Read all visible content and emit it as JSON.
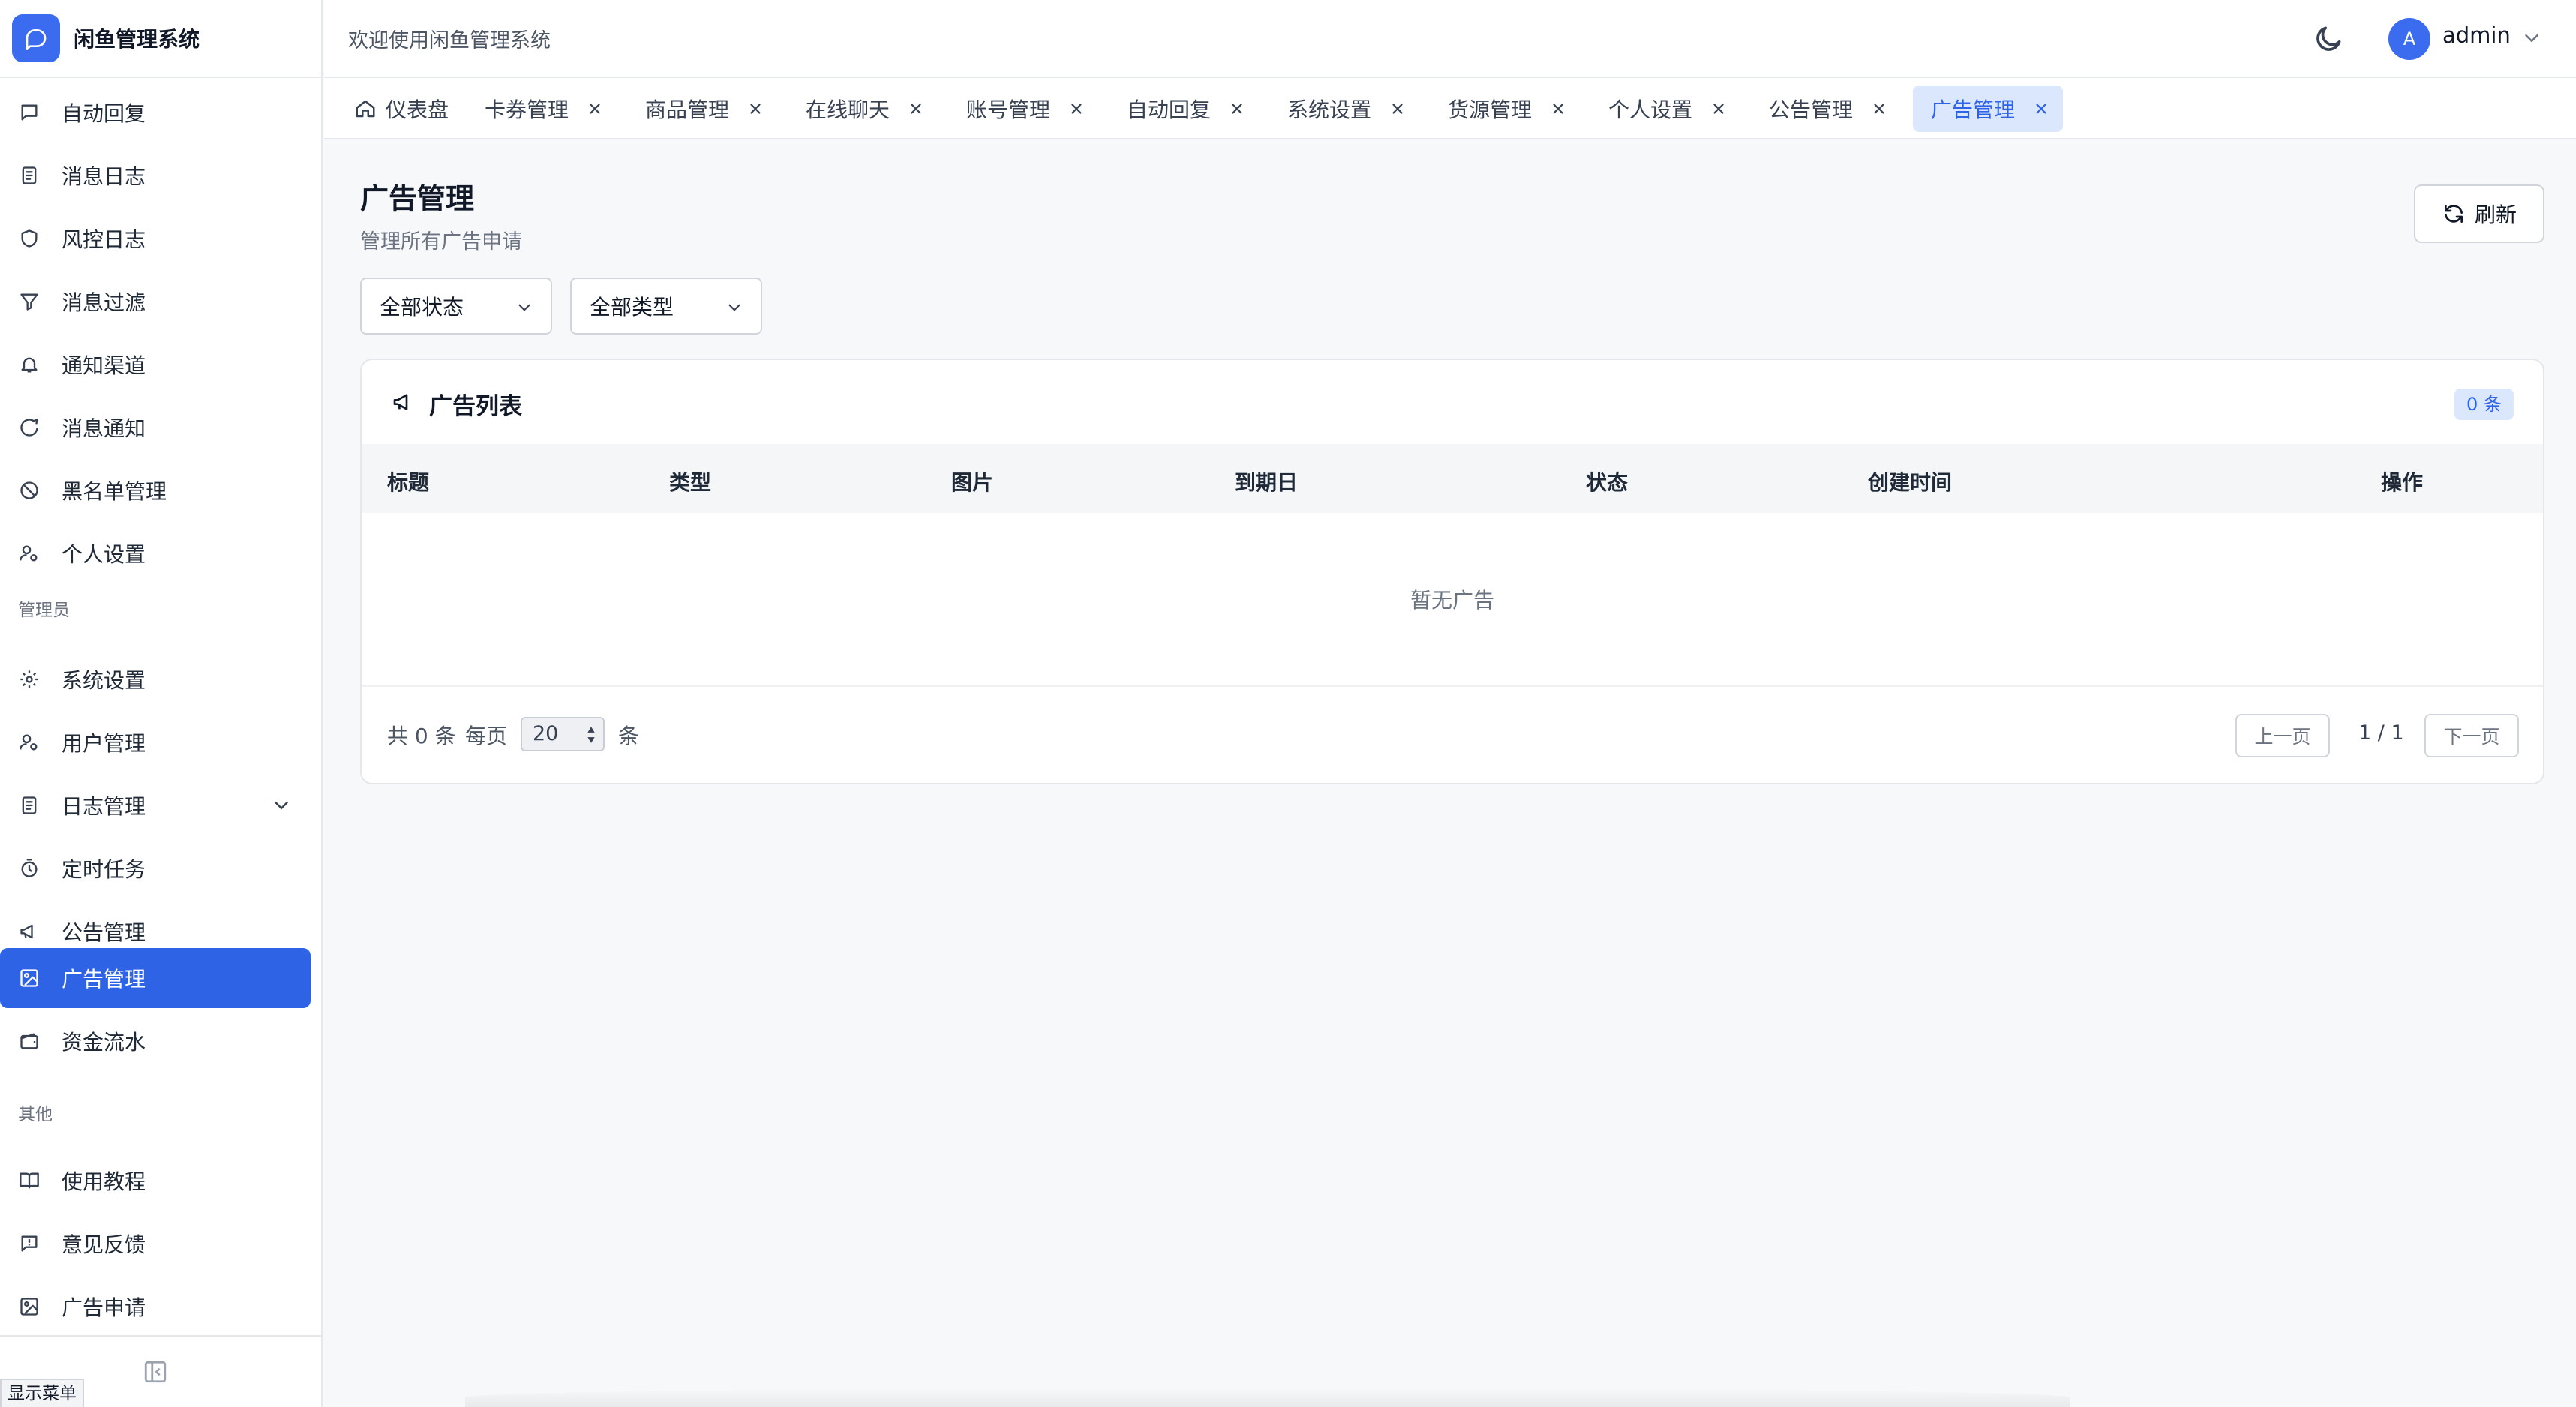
{
  "brand": {
    "name": "闲鱼管理系统"
  },
  "header": {
    "welcome": "欢迎使用闲鱼管理系统",
    "avatar_letter": "A",
    "user": "admin"
  },
  "sidebar": {
    "items": [
      {
        "label": "自动回复",
        "icon": "message-icon"
      },
      {
        "label": "消息日志",
        "icon": "log-icon"
      },
      {
        "label": "风控日志",
        "icon": "shield-icon"
      },
      {
        "label": "消息过滤",
        "icon": "filter-icon"
      },
      {
        "label": "通知渠道",
        "icon": "bell-icon"
      },
      {
        "label": "消息通知",
        "icon": "chat-icon"
      },
      {
        "label": "黑名单管理",
        "icon": "ban-icon"
      },
      {
        "label": "个人设置",
        "icon": "user-gear-icon"
      }
    ],
    "admin_section": "管理员",
    "admin_items": [
      {
        "label": "系统设置",
        "icon": "gear-icon"
      },
      {
        "label": "用户管理",
        "icon": "user-gear-icon"
      },
      {
        "label": "日志管理",
        "icon": "log-icon"
      },
      {
        "label": "定时任务",
        "icon": "timer-icon"
      },
      {
        "label": "公告管理",
        "icon": "megaphone-icon"
      },
      {
        "label": "广告管理",
        "icon": "image-icon"
      },
      {
        "label": "资金流水",
        "icon": "wallet-icon"
      }
    ],
    "other_section": "其他",
    "other_items": [
      {
        "label": "使用教程",
        "icon": "book-icon"
      },
      {
        "label": "意见反馈",
        "icon": "feedback-icon"
      },
      {
        "label": "广告申请",
        "icon": "image-icon"
      }
    ],
    "tooltip": "显示菜单"
  },
  "tabs": [
    {
      "label": "仪表盘"
    },
    {
      "label": "卡券管理"
    },
    {
      "label": "商品管理"
    },
    {
      "label": "在线聊天"
    },
    {
      "label": "账号管理"
    },
    {
      "label": "自动回复"
    },
    {
      "label": "系统设置"
    },
    {
      "label": "货源管理"
    },
    {
      "label": "个人设置"
    },
    {
      "label": "公告管理"
    },
    {
      "label": "广告管理"
    }
  ],
  "page": {
    "title": "广告管理",
    "subtitle": "管理所有广告申请",
    "refresh": "刷新",
    "filter_status": "全部状态",
    "filter_type": "全部类型"
  },
  "table": {
    "title": "广告列表",
    "count": "0 条",
    "columns": [
      "标题",
      "类型",
      "图片",
      "到期日",
      "状态",
      "创建时间",
      "操作"
    ],
    "empty": "暂无广告"
  },
  "pager": {
    "total": "共 0 条",
    "per_page_label": "每页",
    "per_page": "20",
    "unit": "条",
    "prev": "上一页",
    "info": "1 / 1",
    "next": "下一页"
  },
  "colors": {
    "accent": "#2f63e6",
    "accent_light": "#dbe7fd",
    "bg": "#f7f8fa"
  }
}
